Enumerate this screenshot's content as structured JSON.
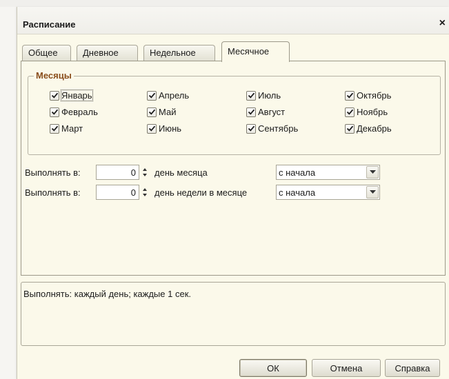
{
  "dialog": {
    "title": "Расписание",
    "close_glyph": "×"
  },
  "tabs": [
    {
      "label": "Общее",
      "active": false
    },
    {
      "label": "Дневное",
      "active": false
    },
    {
      "label": "Недельное",
      "active": false
    },
    {
      "label": "Месячное",
      "active": true
    }
  ],
  "months_group": {
    "title": "Месяцы",
    "items": [
      {
        "label": "Январь",
        "checked": true,
        "focused": true
      },
      {
        "label": "Февраль",
        "checked": true
      },
      {
        "label": "Март",
        "checked": true
      },
      {
        "label": "Апрель",
        "checked": true
      },
      {
        "label": "Май",
        "checked": true
      },
      {
        "label": "Июнь",
        "checked": true
      },
      {
        "label": "Июль",
        "checked": true
      },
      {
        "label": "Август",
        "checked": true
      },
      {
        "label": "Сентябрь",
        "checked": true
      },
      {
        "label": "Октябрь",
        "checked": true
      },
      {
        "label": "Ноябрь",
        "checked": true
      },
      {
        "label": "Декабрь",
        "checked": true
      }
    ]
  },
  "rows": [
    {
      "label": "Выполнять в:",
      "value": "0",
      "suffix": "день месяца",
      "combo": "с начала"
    },
    {
      "label": "Выполнять в:",
      "value": "0",
      "suffix": "день недели в месяце",
      "combo": "с начала"
    }
  ],
  "description": "Выполнять: каждый  день; каждые 1 сек.",
  "buttons": {
    "ok": "ОК",
    "cancel": "Отмена",
    "help": "Справка"
  },
  "icons": {
    "checkbox": "checkmark-icon",
    "spinner": "spinner-up-down-icon",
    "dropdown": "chevron-down-icon",
    "close": "close-icon"
  }
}
